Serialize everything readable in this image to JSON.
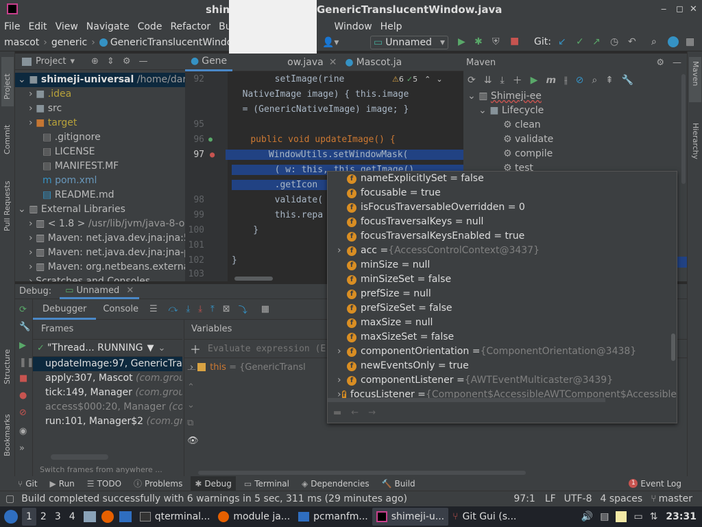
{
  "window": {
    "title": "shimeji-universal - GenericTranslucentWindow.java",
    "title_left": "shim",
    "title_right": "GenericTranslucentWindow.java"
  },
  "menu": [
    "File",
    "Edit",
    "View",
    "Navigate",
    "Code",
    "Refactor",
    "Buil",
    "Window",
    "Help"
  ],
  "nav": {
    "crumbs": [
      "mascot",
      "generic",
      "GenericTranslucentWindow"
    ],
    "run_config": "Unnamed",
    "git_label": "Git:"
  },
  "project": {
    "header": "Project",
    "items": [
      {
        "label": "shimeji-universal",
        "extra": "/home/dartz",
        "bold": true
      },
      {
        "label": ".idea"
      },
      {
        "label": "src"
      },
      {
        "label": "target"
      },
      {
        "label": ".gitignore"
      },
      {
        "label": "LICENSE"
      },
      {
        "label": "MANIFEST.MF"
      },
      {
        "label": "pom.xml"
      },
      {
        "label": "README.md"
      },
      {
        "label": "External Libraries"
      },
      {
        "label": "< 1.8 >",
        "extra": "/usr/lib/jvm/java-8-o"
      },
      {
        "label": "Maven: net.java.dev.jna:jna:5"
      },
      {
        "label": "Maven: net.java.dev.jna:jna-p"
      },
      {
        "label": "Maven: org.netbeans.externa"
      },
      {
        "label": "Scratches and Consoles"
      }
    ]
  },
  "editor": {
    "tabs": [
      "Gene",
      "ow.java",
      "Mascot.ja"
    ],
    "warnings": "6",
    "checks": "5",
    "lines": [
      {
        "n": "92",
        "t": "        setImage(rine"
      },
      {
        "n": "",
        "t": "  NativeImage image) { this.image"
      },
      {
        "n": "",
        "t": "  = (GenericNativeImage) image; }"
      },
      {
        "n": "95",
        "t": ""
      },
      {
        "n": "96",
        "t": "    public void updateImage() {"
      },
      {
        "n": "97",
        "t": "        WindowUtils.setWindowMask("
      },
      {
        "n": "",
        "t": "        ( w: this, this.getImage()."
      },
      {
        "n": "",
        "t": "        .getIcon"
      },
      {
        "n": "98",
        "t": "        validate("
      },
      {
        "n": "99",
        "t": "        this.repa"
      },
      {
        "n": "100",
        "t": "    }"
      },
      {
        "n": "101",
        "t": ""
      },
      {
        "n": "102",
        "t": "}"
      },
      {
        "n": "103",
        "t": ""
      }
    ]
  },
  "maven": {
    "header": "Maven",
    "root": "Shimeji-ee",
    "lifecycle": "Lifecycle",
    "goals": [
      "clean",
      "validate",
      "compile",
      "test"
    ]
  },
  "debug": {
    "label": "Debug:",
    "config": "Unnamed",
    "tabs": [
      "Debugger",
      "Console"
    ],
    "frames_header": "Frames",
    "variables_header": "Variables",
    "thread": "\"Thread... RUNNING",
    "frames": [
      {
        "m": "updateImage:97, GenericTrans",
        "c": ""
      },
      {
        "m": "apply:307, Mascot",
        "c": "(com.group"
      },
      {
        "m": "tick:149, Manager",
        "c": "(com.group_"
      },
      {
        "m": "access$000:20, Manager",
        "c": "(com"
      },
      {
        "m": "run:101, Manager$2",
        "c": "(com.grou"
      }
    ],
    "switch_hint": "Switch frames from anywhere ...",
    "eval_placeholder": "Evaluate expression (E",
    "var_this": "this",
    "var_this_val": "= {GenericTransl"
  },
  "popup": [
    {
      "k": "nameExplicitlySet",
      "v": "= false"
    },
    {
      "k": "focusable",
      "v": "= true"
    },
    {
      "k": "isFocusTraversableOverridden",
      "v": "= 0"
    },
    {
      "k": "focusTraversalKeys",
      "v": "= null"
    },
    {
      "k": "focusTraversalKeysEnabled",
      "v": "= true"
    },
    {
      "k": "acc",
      "v": "= ",
      "g": "{AccessControlContext@3437}",
      "exp": true
    },
    {
      "k": "minSize",
      "v": "= null"
    },
    {
      "k": "minSizeSet",
      "v": "= false"
    },
    {
      "k": "prefSize",
      "v": "= null"
    },
    {
      "k": "prefSizeSet",
      "v": "= false"
    },
    {
      "k": "maxSize",
      "v": "= null"
    },
    {
      "k": "maxSizeSet",
      "v": "= false"
    },
    {
      "k": "componentOrientation",
      "v": "= ",
      "g": "{ComponentOrientation@3438}",
      "exp": true
    },
    {
      "k": "newEventsOnly",
      "v": "= true"
    },
    {
      "k": "componentListener",
      "v": "= ",
      "g": "{AWTEventMulticaster@3439}",
      "exp": true
    },
    {
      "k": "focusListener",
      "v": "= ",
      "g": "{Component$AccessibleAWTComponent$Accessible",
      "exp": true
    }
  ],
  "toolwindows": [
    "Git",
    "Run",
    "TODO",
    "Problems",
    "Debug",
    "Terminal",
    "Dependencies",
    "Build"
  ],
  "event_log": {
    "count": "1",
    "label": "Event Log"
  },
  "status": {
    "msg": "Build completed successfully with 6 warnings in 5 sec, 311 ms (29 minutes ago)",
    "pos": "97:1",
    "lf": "LF",
    "enc": "UTF-8",
    "indent": "4 spaces",
    "branch": "master"
  },
  "side_left": [
    "Project",
    "Commit",
    "Pull Requests",
    "Structure",
    "Bookmarks"
  ],
  "side_right": [
    "Maven",
    "Hierarchy"
  ],
  "taskbar": {
    "desktops": [
      "1",
      "2",
      "3",
      "4"
    ],
    "apps": [
      "qterminal...",
      "module ja...",
      "pcmanfm...",
      "shimeji-u...",
      "Git Gui (s..."
    ],
    "clock": "23:31"
  }
}
